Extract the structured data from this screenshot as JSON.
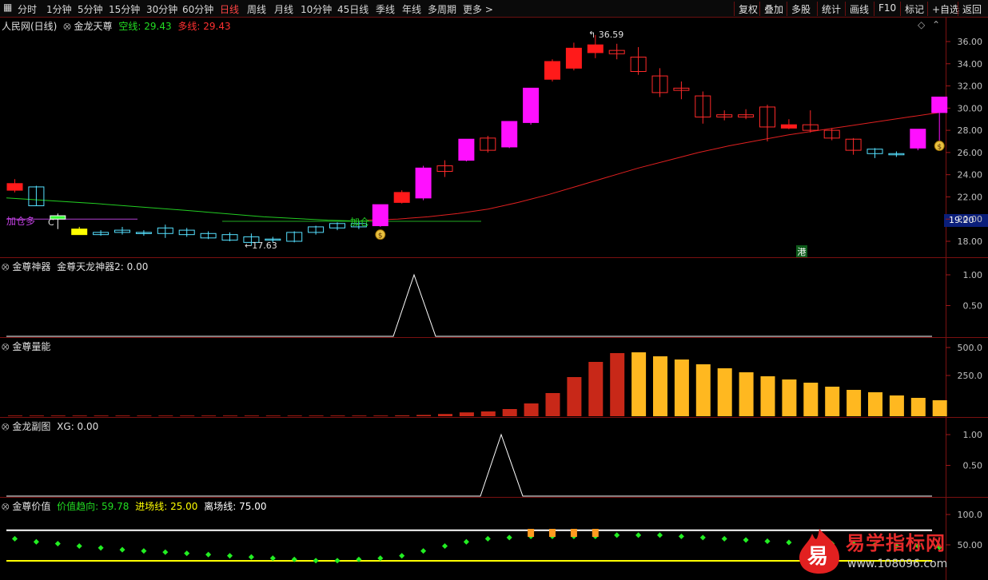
{
  "toolbar": {
    "left": [
      "分时",
      "1分钟",
      "5分钟",
      "15分钟",
      "30分钟",
      "60分钟",
      "日线",
      "周线",
      "月线",
      "10分钟",
      "45日线",
      "季线",
      "年线",
      "多周期",
      "更多 >"
    ],
    "active_index": 6,
    "right": [
      "复权",
      "叠加",
      "多股",
      "统计",
      "画线",
      "F10",
      "标记",
      "+自选",
      "返回"
    ]
  },
  "main": {
    "stock": "人民网(日线)",
    "indicator": "金龙天尊",
    "kong_label": "空线: 29.43",
    "duo_label": "多线: 29.43",
    "y_ticks": [
      "36.00",
      "34.00",
      "32.00",
      "30.00",
      "28.00",
      "26.00",
      "24.00",
      "22.00",
      "20.00",
      "18.00"
    ],
    "high_label": "36.59",
    "low_label": "17.63",
    "current_price": "19.20",
    "annotation_jiacangduo": "加仓多",
    "annotation_c": "C",
    "annotation_jia": "加仓",
    "annotation_gang": "港",
    "marker_symbol": "$"
  },
  "pane1": {
    "name": "金尊神器",
    "value_label": "金尊天龙神器2: 0.00",
    "y_ticks": [
      "1.00",
      "0.50"
    ]
  },
  "pane2": {
    "name": "金尊量能",
    "y_ticks": [
      "500.0",
      "250.0"
    ]
  },
  "pane3": {
    "name": "金龙副图",
    "value_label": "XG: 0.00",
    "y_ticks": [
      "1.00",
      "0.50"
    ]
  },
  "pane4": {
    "name": "金尊价值",
    "trend_label": "价值趋向: 59.78",
    "entry_label": "进场线: 25.00",
    "exit_label": "离场线: 75.00",
    "y_ticks": [
      "100.0",
      "50.00"
    ]
  },
  "watermark": {
    "logo_char": "易",
    "text": "易学指标网",
    "url": "www.108096.com"
  },
  "chart_data": {
    "type": "candlestick",
    "candles": [
      {
        "o": 22.6,
        "h": 23.6,
        "l": 22.4,
        "c": 23.2,
        "k": "r"
      },
      {
        "o": 22.9,
        "h": 23.0,
        "l": 21.2,
        "c": 21.2,
        "k": "c"
      },
      {
        "o": 20.0,
        "h": 20.5,
        "l": 19.1,
        "c": 20.3,
        "k": "g"
      },
      {
        "o": 19.1,
        "h": 19.3,
        "l": 18.6,
        "c": 18.6,
        "k": "y"
      },
      {
        "o": 18.8,
        "h": 19.0,
        "l": 18.5,
        "c": 18.6,
        "k": "c"
      },
      {
        "o": 19.0,
        "h": 19.3,
        "l": 18.6,
        "c": 18.8,
        "k": "c"
      },
      {
        "o": 18.8,
        "h": 19.0,
        "l": 18.5,
        "c": 18.7,
        "k": "c"
      },
      {
        "o": 19.2,
        "h": 19.5,
        "l": 18.3,
        "c": 18.7,
        "k": "c"
      },
      {
        "o": 19.0,
        "h": 19.2,
        "l": 18.4,
        "c": 18.6,
        "k": "c"
      },
      {
        "o": 18.7,
        "h": 18.9,
        "l": 18.2,
        "c": 18.3,
        "k": "c"
      },
      {
        "o": 18.6,
        "h": 18.8,
        "l": 18.0,
        "c": 18.1,
        "k": "c"
      },
      {
        "o": 18.4,
        "h": 18.7,
        "l": 17.63,
        "c": 17.9,
        "k": "c"
      },
      {
        "o": 18.2,
        "h": 18.4,
        "l": 17.9,
        "c": 18.2,
        "k": "c"
      },
      {
        "o": 18.0,
        "h": 18.9,
        "l": 17.9,
        "c": 18.8,
        "k": "c"
      },
      {
        "o": 18.8,
        "h": 19.4,
        "l": 18.6,
        "c": 19.3,
        "k": "c"
      },
      {
        "o": 19.2,
        "h": 19.7,
        "l": 19.0,
        "c": 19.6,
        "k": "c"
      },
      {
        "o": 19.3,
        "h": 19.8,
        "l": 19.1,
        "c": 19.6,
        "k": "c"
      },
      {
        "o": 19.4,
        "h": 21.3,
        "l": 19.3,
        "c": 21.3,
        "k": "m"
      },
      {
        "o": 21.5,
        "h": 22.6,
        "l": 21.4,
        "c": 22.4,
        "k": "r"
      },
      {
        "o": 21.9,
        "h": 24.8,
        "l": 21.7,
        "c": 24.6,
        "k": "m"
      },
      {
        "o": 24.3,
        "h": 25.3,
        "l": 23.8,
        "c": 24.8,
        "k": "ro"
      },
      {
        "o": 25.3,
        "h": 27.2,
        "l": 25.2,
        "c": 27.2,
        "k": "m"
      },
      {
        "o": 26.2,
        "h": 27.5,
        "l": 26.0,
        "c": 27.3,
        "k": "ro"
      },
      {
        "o": 26.5,
        "h": 28.8,
        "l": 26.4,
        "c": 28.8,
        "k": "m"
      },
      {
        "o": 28.7,
        "h": 31.8,
        "l": 28.5,
        "c": 31.8,
        "k": "m"
      },
      {
        "o": 32.6,
        "h": 34.4,
        "l": 32.4,
        "c": 34.2,
        "k": "r"
      },
      {
        "o": 33.6,
        "h": 35.9,
        "l": 33.4,
        "c": 35.4,
        "k": "r"
      },
      {
        "o": 35.0,
        "h": 36.59,
        "l": 34.5,
        "c": 35.7,
        "k": "r"
      },
      {
        "o": 35.2,
        "h": 35.8,
        "l": 34.4,
        "c": 34.9,
        "k": "ro"
      },
      {
        "o": 34.6,
        "h": 35.5,
        "l": 33.0,
        "c": 33.3,
        "k": "ro"
      },
      {
        "o": 32.9,
        "h": 33.6,
        "l": 31.0,
        "c": 31.4,
        "k": "ro"
      },
      {
        "o": 31.8,
        "h": 32.4,
        "l": 30.8,
        "c": 31.6,
        "k": "ro"
      },
      {
        "o": 31.1,
        "h": 31.5,
        "l": 28.6,
        "c": 29.2,
        "k": "ro"
      },
      {
        "o": 29.4,
        "h": 29.8,
        "l": 28.9,
        "c": 29.2,
        "k": "ro"
      },
      {
        "o": 29.4,
        "h": 29.9,
        "l": 29.0,
        "c": 29.2,
        "k": "ro"
      },
      {
        "o": 30.1,
        "h": 30.3,
        "l": 27.0,
        "c": 28.3,
        "k": "ro"
      },
      {
        "o": 28.5,
        "h": 29.0,
        "l": 28.1,
        "c": 28.2,
        "k": "r"
      },
      {
        "o": 28.5,
        "h": 29.8,
        "l": 27.8,
        "c": 28.0,
        "k": "ro"
      },
      {
        "o": 28.0,
        "h": 28.2,
        "l": 27.1,
        "c": 27.3,
        "k": "ro"
      },
      {
        "o": 27.2,
        "h": 27.3,
        "l": 25.8,
        "c": 26.2,
        "k": "ro"
      },
      {
        "o": 25.9,
        "h": 26.4,
        "l": 25.5,
        "c": 26.3,
        "k": "c"
      },
      {
        "o": 25.9,
        "h": 26.1,
        "l": 25.6,
        "c": 25.8,
        "k": "c"
      },
      {
        "o": 26.4,
        "h": 28.1,
        "l": 26.2,
        "c": 28.1,
        "k": "m"
      },
      {
        "o": 29.6,
        "h": 31.0,
        "l": 27.0,
        "c": 31.0,
        "k": "m"
      }
    ],
    "volume": [
      2,
      2,
      2,
      2,
      2,
      2,
      2,
      2,
      2,
      2,
      2,
      2,
      2,
      2,
      2,
      2,
      2,
      2,
      3,
      8,
      14,
      24,
      30,
      45,
      80,
      145,
      245,
      340,
      395,
      400,
      375,
      355,
      325,
      300,
      275,
      250,
      230,
      210,
      185,
      165,
      150,
      130,
      115,
      100
    ],
    "value_trend": [
      60,
      55,
      52,
      48,
      45,
      42,
      40,
      38,
      36,
      34,
      32,
      30,
      28,
      26,
      24,
      24,
      26,
      28,
      32,
      40,
      48,
      55,
      60,
      62,
      64,
      64,
      64,
      64,
      66,
      66,
      66,
      64,
      62,
      60,
      58,
      56,
      54,
      54,
      52,
      52,
      50,
      48,
      48,
      46
    ],
    "entry_line": 25,
    "exit_line": 75
  }
}
